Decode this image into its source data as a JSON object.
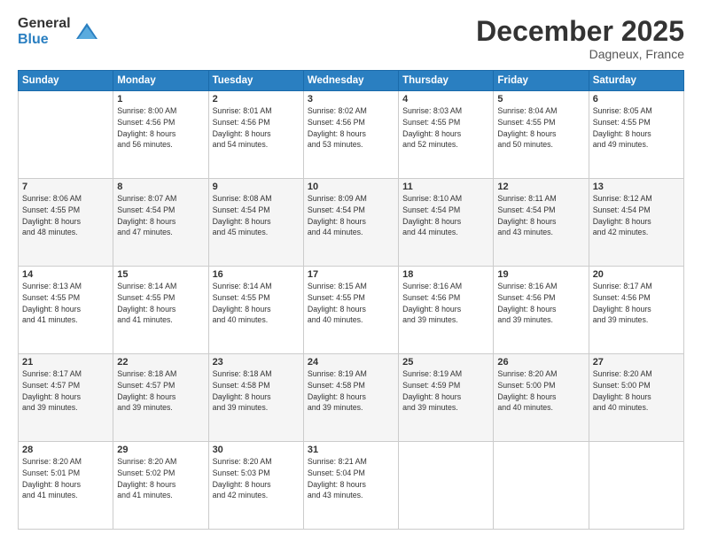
{
  "logo": {
    "general": "General",
    "blue": "Blue"
  },
  "header": {
    "month": "December 2025",
    "location": "Dagneux, France"
  },
  "weekdays": [
    "Sunday",
    "Monday",
    "Tuesday",
    "Wednesday",
    "Thursday",
    "Friday",
    "Saturday"
  ],
  "weeks": [
    [
      {
        "day": "",
        "info": ""
      },
      {
        "day": "1",
        "info": "Sunrise: 8:00 AM\nSunset: 4:56 PM\nDaylight: 8 hours\nand 56 minutes."
      },
      {
        "day": "2",
        "info": "Sunrise: 8:01 AM\nSunset: 4:56 PM\nDaylight: 8 hours\nand 54 minutes."
      },
      {
        "day": "3",
        "info": "Sunrise: 8:02 AM\nSunset: 4:56 PM\nDaylight: 8 hours\nand 53 minutes."
      },
      {
        "day": "4",
        "info": "Sunrise: 8:03 AM\nSunset: 4:55 PM\nDaylight: 8 hours\nand 52 minutes."
      },
      {
        "day": "5",
        "info": "Sunrise: 8:04 AM\nSunset: 4:55 PM\nDaylight: 8 hours\nand 50 minutes."
      },
      {
        "day": "6",
        "info": "Sunrise: 8:05 AM\nSunset: 4:55 PM\nDaylight: 8 hours\nand 49 minutes."
      }
    ],
    [
      {
        "day": "7",
        "info": "Sunrise: 8:06 AM\nSunset: 4:55 PM\nDaylight: 8 hours\nand 48 minutes."
      },
      {
        "day": "8",
        "info": "Sunrise: 8:07 AM\nSunset: 4:54 PM\nDaylight: 8 hours\nand 47 minutes."
      },
      {
        "day": "9",
        "info": "Sunrise: 8:08 AM\nSunset: 4:54 PM\nDaylight: 8 hours\nand 45 minutes."
      },
      {
        "day": "10",
        "info": "Sunrise: 8:09 AM\nSunset: 4:54 PM\nDaylight: 8 hours\nand 44 minutes."
      },
      {
        "day": "11",
        "info": "Sunrise: 8:10 AM\nSunset: 4:54 PM\nDaylight: 8 hours\nand 44 minutes."
      },
      {
        "day": "12",
        "info": "Sunrise: 8:11 AM\nSunset: 4:54 PM\nDaylight: 8 hours\nand 43 minutes."
      },
      {
        "day": "13",
        "info": "Sunrise: 8:12 AM\nSunset: 4:54 PM\nDaylight: 8 hours\nand 42 minutes."
      }
    ],
    [
      {
        "day": "14",
        "info": "Sunrise: 8:13 AM\nSunset: 4:55 PM\nDaylight: 8 hours\nand 41 minutes."
      },
      {
        "day": "15",
        "info": "Sunrise: 8:14 AM\nSunset: 4:55 PM\nDaylight: 8 hours\nand 41 minutes."
      },
      {
        "day": "16",
        "info": "Sunrise: 8:14 AM\nSunset: 4:55 PM\nDaylight: 8 hours\nand 40 minutes."
      },
      {
        "day": "17",
        "info": "Sunrise: 8:15 AM\nSunset: 4:55 PM\nDaylight: 8 hours\nand 40 minutes."
      },
      {
        "day": "18",
        "info": "Sunrise: 8:16 AM\nSunset: 4:56 PM\nDaylight: 8 hours\nand 39 minutes."
      },
      {
        "day": "19",
        "info": "Sunrise: 8:16 AM\nSunset: 4:56 PM\nDaylight: 8 hours\nand 39 minutes."
      },
      {
        "day": "20",
        "info": "Sunrise: 8:17 AM\nSunset: 4:56 PM\nDaylight: 8 hours\nand 39 minutes."
      }
    ],
    [
      {
        "day": "21",
        "info": "Sunrise: 8:17 AM\nSunset: 4:57 PM\nDaylight: 8 hours\nand 39 minutes."
      },
      {
        "day": "22",
        "info": "Sunrise: 8:18 AM\nSunset: 4:57 PM\nDaylight: 8 hours\nand 39 minutes."
      },
      {
        "day": "23",
        "info": "Sunrise: 8:18 AM\nSunset: 4:58 PM\nDaylight: 8 hours\nand 39 minutes."
      },
      {
        "day": "24",
        "info": "Sunrise: 8:19 AM\nSunset: 4:58 PM\nDaylight: 8 hours\nand 39 minutes."
      },
      {
        "day": "25",
        "info": "Sunrise: 8:19 AM\nSunset: 4:59 PM\nDaylight: 8 hours\nand 39 minutes."
      },
      {
        "day": "26",
        "info": "Sunrise: 8:20 AM\nSunset: 5:00 PM\nDaylight: 8 hours\nand 40 minutes."
      },
      {
        "day": "27",
        "info": "Sunrise: 8:20 AM\nSunset: 5:00 PM\nDaylight: 8 hours\nand 40 minutes."
      }
    ],
    [
      {
        "day": "28",
        "info": "Sunrise: 8:20 AM\nSunset: 5:01 PM\nDaylight: 8 hours\nand 41 minutes."
      },
      {
        "day": "29",
        "info": "Sunrise: 8:20 AM\nSunset: 5:02 PM\nDaylight: 8 hours\nand 41 minutes."
      },
      {
        "day": "30",
        "info": "Sunrise: 8:20 AM\nSunset: 5:03 PM\nDaylight: 8 hours\nand 42 minutes."
      },
      {
        "day": "31",
        "info": "Sunrise: 8:21 AM\nSunset: 5:04 PM\nDaylight: 8 hours\nand 43 minutes."
      },
      {
        "day": "",
        "info": ""
      },
      {
        "day": "",
        "info": ""
      },
      {
        "day": "",
        "info": ""
      }
    ]
  ]
}
